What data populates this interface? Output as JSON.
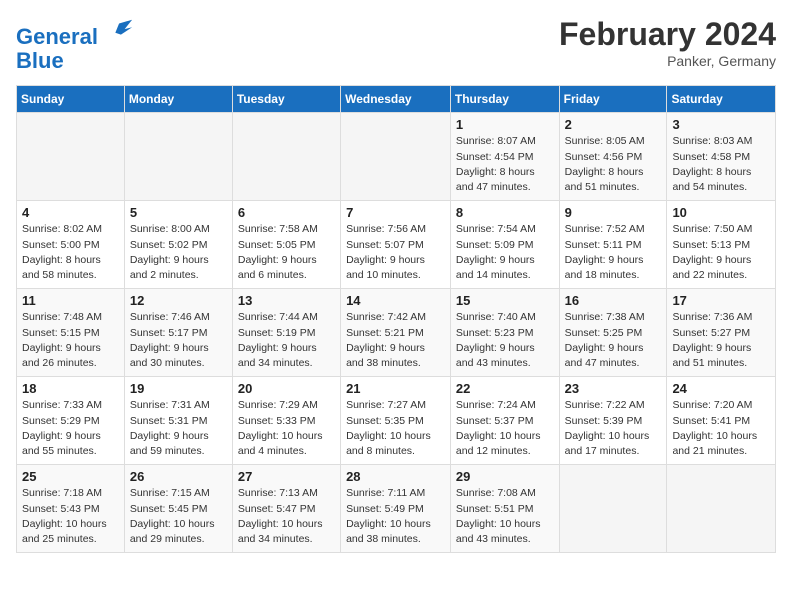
{
  "header": {
    "logo_line1": "General",
    "logo_line2": "Blue",
    "month_year": "February 2024",
    "location": "Panker, Germany"
  },
  "days_of_week": [
    "Sunday",
    "Monday",
    "Tuesday",
    "Wednesday",
    "Thursday",
    "Friday",
    "Saturday"
  ],
  "weeks": [
    [
      {
        "day": "",
        "detail": ""
      },
      {
        "day": "",
        "detail": ""
      },
      {
        "day": "",
        "detail": ""
      },
      {
        "day": "",
        "detail": ""
      },
      {
        "day": "1",
        "detail": "Sunrise: 8:07 AM\nSunset: 4:54 PM\nDaylight: 8 hours\nand 47 minutes."
      },
      {
        "day": "2",
        "detail": "Sunrise: 8:05 AM\nSunset: 4:56 PM\nDaylight: 8 hours\nand 51 minutes."
      },
      {
        "day": "3",
        "detail": "Sunrise: 8:03 AM\nSunset: 4:58 PM\nDaylight: 8 hours\nand 54 minutes."
      }
    ],
    [
      {
        "day": "4",
        "detail": "Sunrise: 8:02 AM\nSunset: 5:00 PM\nDaylight: 8 hours\nand 58 minutes."
      },
      {
        "day": "5",
        "detail": "Sunrise: 8:00 AM\nSunset: 5:02 PM\nDaylight: 9 hours\nand 2 minutes."
      },
      {
        "day": "6",
        "detail": "Sunrise: 7:58 AM\nSunset: 5:05 PM\nDaylight: 9 hours\nand 6 minutes."
      },
      {
        "day": "7",
        "detail": "Sunrise: 7:56 AM\nSunset: 5:07 PM\nDaylight: 9 hours\nand 10 minutes."
      },
      {
        "day": "8",
        "detail": "Sunrise: 7:54 AM\nSunset: 5:09 PM\nDaylight: 9 hours\nand 14 minutes."
      },
      {
        "day": "9",
        "detail": "Sunrise: 7:52 AM\nSunset: 5:11 PM\nDaylight: 9 hours\nand 18 minutes."
      },
      {
        "day": "10",
        "detail": "Sunrise: 7:50 AM\nSunset: 5:13 PM\nDaylight: 9 hours\nand 22 minutes."
      }
    ],
    [
      {
        "day": "11",
        "detail": "Sunrise: 7:48 AM\nSunset: 5:15 PM\nDaylight: 9 hours\nand 26 minutes."
      },
      {
        "day": "12",
        "detail": "Sunrise: 7:46 AM\nSunset: 5:17 PM\nDaylight: 9 hours\nand 30 minutes."
      },
      {
        "day": "13",
        "detail": "Sunrise: 7:44 AM\nSunset: 5:19 PM\nDaylight: 9 hours\nand 34 minutes."
      },
      {
        "day": "14",
        "detail": "Sunrise: 7:42 AM\nSunset: 5:21 PM\nDaylight: 9 hours\nand 38 minutes."
      },
      {
        "day": "15",
        "detail": "Sunrise: 7:40 AM\nSunset: 5:23 PM\nDaylight: 9 hours\nand 43 minutes."
      },
      {
        "day": "16",
        "detail": "Sunrise: 7:38 AM\nSunset: 5:25 PM\nDaylight: 9 hours\nand 47 minutes."
      },
      {
        "day": "17",
        "detail": "Sunrise: 7:36 AM\nSunset: 5:27 PM\nDaylight: 9 hours\nand 51 minutes."
      }
    ],
    [
      {
        "day": "18",
        "detail": "Sunrise: 7:33 AM\nSunset: 5:29 PM\nDaylight: 9 hours\nand 55 minutes."
      },
      {
        "day": "19",
        "detail": "Sunrise: 7:31 AM\nSunset: 5:31 PM\nDaylight: 9 hours\nand 59 minutes."
      },
      {
        "day": "20",
        "detail": "Sunrise: 7:29 AM\nSunset: 5:33 PM\nDaylight: 10 hours\nand 4 minutes."
      },
      {
        "day": "21",
        "detail": "Sunrise: 7:27 AM\nSunset: 5:35 PM\nDaylight: 10 hours\nand 8 minutes."
      },
      {
        "day": "22",
        "detail": "Sunrise: 7:24 AM\nSunset: 5:37 PM\nDaylight: 10 hours\nand 12 minutes."
      },
      {
        "day": "23",
        "detail": "Sunrise: 7:22 AM\nSunset: 5:39 PM\nDaylight: 10 hours\nand 17 minutes."
      },
      {
        "day": "24",
        "detail": "Sunrise: 7:20 AM\nSunset: 5:41 PM\nDaylight: 10 hours\nand 21 minutes."
      }
    ],
    [
      {
        "day": "25",
        "detail": "Sunrise: 7:18 AM\nSunset: 5:43 PM\nDaylight: 10 hours\nand 25 minutes."
      },
      {
        "day": "26",
        "detail": "Sunrise: 7:15 AM\nSunset: 5:45 PM\nDaylight: 10 hours\nand 29 minutes."
      },
      {
        "day": "27",
        "detail": "Sunrise: 7:13 AM\nSunset: 5:47 PM\nDaylight: 10 hours\nand 34 minutes."
      },
      {
        "day": "28",
        "detail": "Sunrise: 7:11 AM\nSunset: 5:49 PM\nDaylight: 10 hours\nand 38 minutes."
      },
      {
        "day": "29",
        "detail": "Sunrise: 7:08 AM\nSunset: 5:51 PM\nDaylight: 10 hours\nand 43 minutes."
      },
      {
        "day": "",
        "detail": ""
      },
      {
        "day": "",
        "detail": ""
      }
    ]
  ]
}
